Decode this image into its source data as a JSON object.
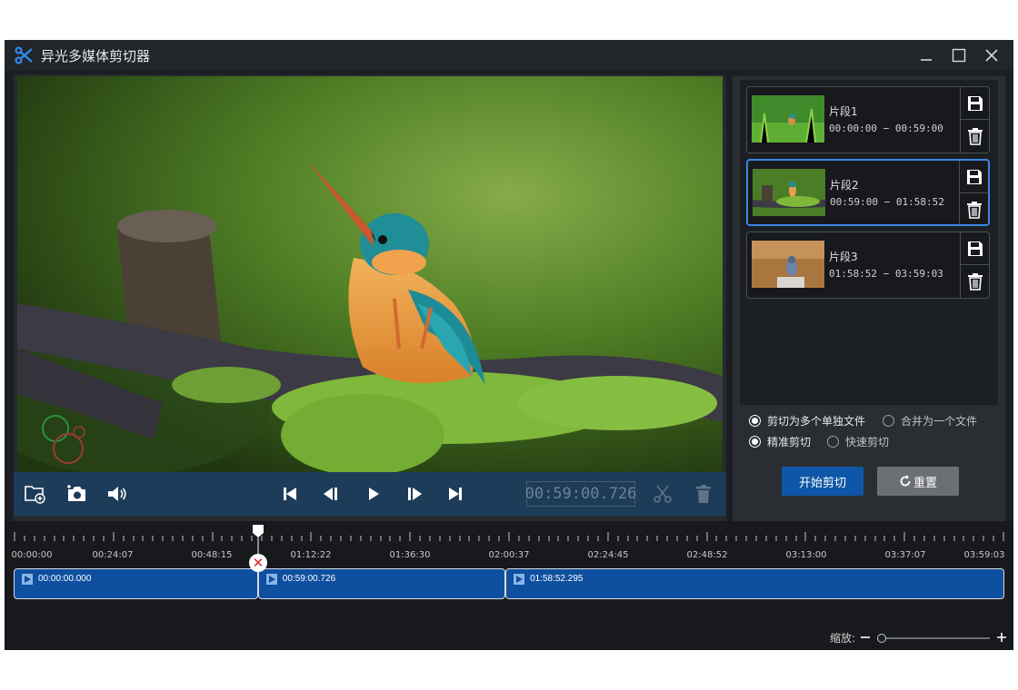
{
  "app": {
    "title": "异光多媒体剪切器"
  },
  "player": {
    "current_time": "00:59:00.726",
    "controls": [
      "open-folder",
      "snapshot",
      "volume",
      "skip-to-start",
      "prev-frame",
      "play",
      "next-frame",
      "skip-to-end",
      "cut",
      "delete"
    ]
  },
  "clips": [
    {
      "name": "片段1",
      "range": "00:00:00 − 00:59:00",
      "selected": false
    },
    {
      "name": "片段2",
      "range": "00:59:00 − 01:58:52",
      "selected": true
    },
    {
      "name": "片段3",
      "range": "01:58:52 − 03:59:03",
      "selected": false
    }
  ],
  "options": {
    "output_separate": "剪切为多个单独文件",
    "output_merge": "合并为一个文件",
    "mode_precise": "精准剪切",
    "mode_fast": "快速剪切"
  },
  "buttons": {
    "start": "开始剪切",
    "reset": "重置"
  },
  "timeline": {
    "ticks": [
      "00:00:00",
      "00:24:07",
      "00:48:15",
      "01:12:22",
      "01:36:30",
      "02:00:37",
      "02:24:45",
      "02:48:52",
      "03:13:00",
      "03:37:07",
      "03:59:03"
    ],
    "segments": [
      {
        "label": "00:00:00.000",
        "start_fraction": 0.0,
        "end_fraction": 0.2466
      },
      {
        "label": "00:59:00.726",
        "start_fraction": 0.2466,
        "end_fraction": 0.4964
      },
      {
        "label": "01:58:52.295",
        "start_fraction": 0.4964,
        "end_fraction": 1.0
      }
    ],
    "playhead_fraction": 0.2466
  },
  "zoom": {
    "label": "缩放:",
    "level_fraction": 0.0
  },
  "colors": {
    "accent": "#0e57a8",
    "selected_border": "#3a86e6",
    "segment": "#0e4fa0",
    "panel": "#2a2e33"
  }
}
